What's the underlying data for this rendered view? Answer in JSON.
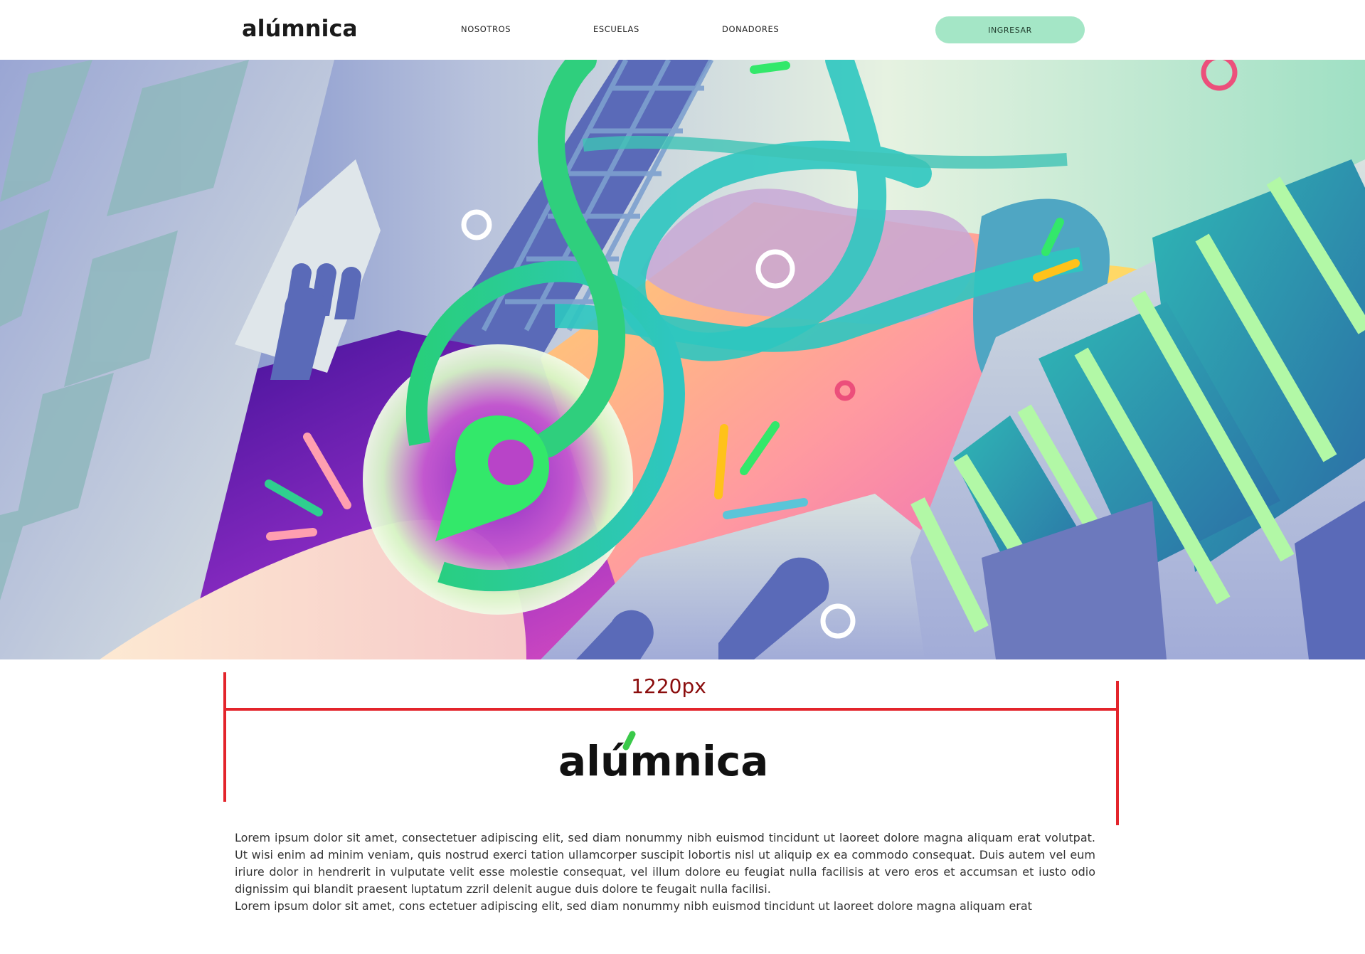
{
  "brand": {
    "name": "alúmnica",
    "accent_green": "#3ac94a",
    "button_color": "#a4e6c6"
  },
  "nav": {
    "items": [
      "NOSOTROS",
      "ESCUELAS",
      "DONADORES"
    ],
    "login_label": "INGRESAR"
  },
  "hero": {
    "illustration": "abstract city illustration with location pin",
    "icons": [
      "location-pin-icon"
    ]
  },
  "measure": {
    "label": "1220px",
    "color": "#e3242b",
    "label_color": "#8b0d0d"
  },
  "content": {
    "paragraph": "Lorem ipsum dolor sit amet, consectetuer adipiscing elit, sed diam nonummy nibh euismod tincidunt ut laoreet dolore magna aliquam erat volutpat. Ut wisi enim ad minim veniam, quis nostrud exerci tation ullamcorper suscipit lobortis nisl ut aliquip ex ea commodo consequat. Duis autem vel eum iriure dolor in hendrerit in vulputate velit esse molestie consequat, vel illum dolore eu feugiat nulla facilisis at vero eros et accumsan et iusto odio dignissim qui blandit praesent luptatum zzril delenit augue duis dolore te feugait nulla facilisi.",
    "paragraph_2": "Lorem ipsum dolor sit amet, cons ectetuer adipiscing elit, sed diam nonummy nibh euismod tincidunt ut laoreet dolore magna aliquam erat"
  }
}
